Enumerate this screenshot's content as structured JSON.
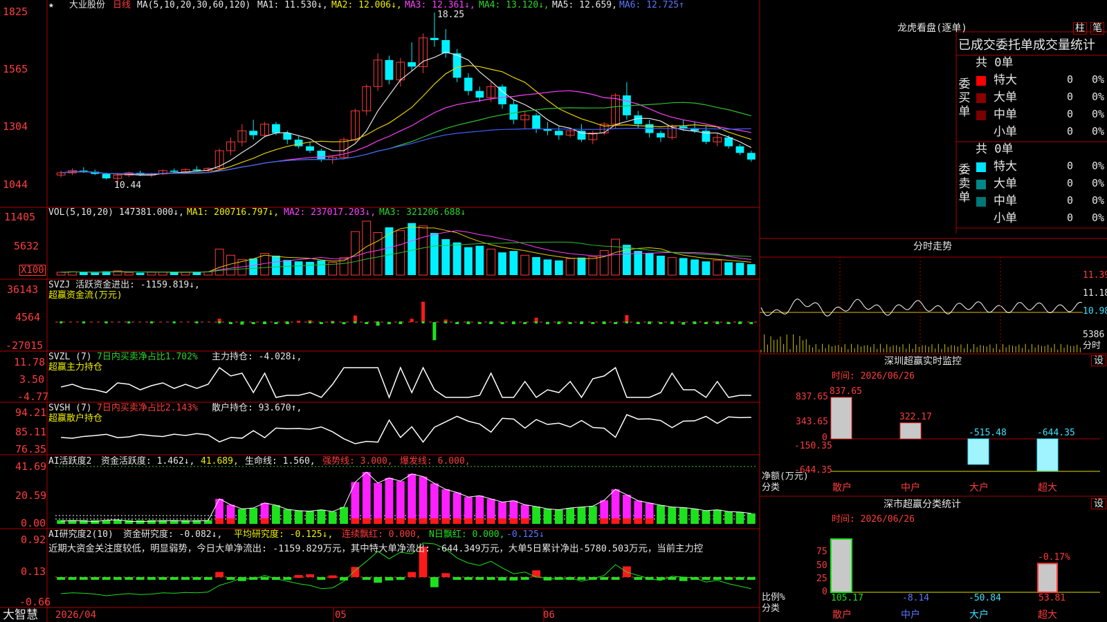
{
  "colors": {
    "bg": "#000000",
    "grid": "#b00000",
    "up": "#ff3c3c",
    "down": "#00f0ff",
    "ma1": "#e8e8e8",
    "ma2": "#e8d000",
    "ma3": "#ff40ff",
    "ma4": "#30c030",
    "ma5": "#4060ff",
    "ma6": "#4060ff"
  },
  "header": {
    "star": "★",
    "stock_name": "大业股份",
    "period": "日线",
    "ma_params": "MA(5,10,20,30,60,120)",
    "ma1": "MA1: 11.530↓,",
    "ma2": "MA2: 12.006↓,",
    "ma3": "MA3: 12.361↓,",
    "ma4": "MA4: 13.120↓,",
    "ma5": "MA5: 12.659,",
    "ma6": "MA6: 12.725↑"
  },
  "price_axis": [
    "1825",
    "1565",
    "1304",
    "1044"
  ],
  "price_labels": {
    "high": "18.25",
    "low": "10.44"
  },
  "vol": {
    "params": "VOL(5,10,20)",
    "value": "147381.000↓,",
    "ma1": "MA1: 200716.797↓,",
    "ma2": "MA2: 237017.203↓,",
    "ma3": "MA3: 321206.688↓",
    "axis": [
      "11405",
      "5632"
    ],
    "unit": "X100"
  },
  "svzj": {
    "title": "SVZJ  活跃资金进出: -1159.819↓,",
    "subtitle": "超赢资金流(万元)",
    "axis": [
      "36143",
      "4564",
      "-27015"
    ]
  },
  "svzl": {
    "title": "SVZL  (7)",
    "mid": "7日内买卖净占比1.702%",
    "tail": "主力持仓: -4.028↓,",
    "subtitle": "超赢主力持仓",
    "axis": [
      "11.78",
      "3.50",
      "-4.77"
    ]
  },
  "svsh": {
    "title": "SVSH  (7)",
    "mid": "7日内买卖净占比2.143%",
    "tail": "散户持仓: 93.670↑,",
    "subtitle": "超赢散户持仓",
    "axis": [
      "94.21",
      "85.11",
      "76.35"
    ]
  },
  "ai1": {
    "a": "AI活跃度2",
    "b": "资金活跃度: 1.462↓,",
    "c": "41.689,",
    "d": "生命线: 1.560,",
    "e": "强势线: 3.000,",
    "f": "爆发线: 6.000,",
    "axis": [
      "41.69",
      "20.59",
      "0.00"
    ]
  },
  "ai2": {
    "a": "AI研究度2(10)",
    "b": "资金研究度: -0.082↓,",
    "c": "平均研究度: -0.125↓,",
    "d": "连续飘红: 0.000,",
    "e": "N日飘红: 0.000,",
    "f": "-0.125↓",
    "axis": [
      "0.92",
      "0.13",
      "-0.66"
    ],
    "note": "近期大资金关注度较低，明显弱势，今日大单净流出: -1159.829万元，其中特大单净流出: -644.349万元，大单5日累计净出-5780.503万元，当前主力控"
  },
  "footer": {
    "brand": "大智慧",
    "dates": [
      "2026/04",
      "05",
      "06"
    ]
  },
  "dragon": {
    "title": "龙虎看盘(逐单)",
    "btn1": "柱",
    "btn2": "笔",
    "section": "已成交委托单成交量统计",
    "buy_label": "委买单",
    "sell_label": "委卖单",
    "buy_total": "共 0单",
    "sell_total": "共 0单",
    "buy": [
      {
        "name": "特大",
        "count": "0",
        "pct": "0%",
        "color": "#ff0000"
      },
      {
        "name": "大单",
        "count": "0",
        "pct": "0%",
        "color": "#8b0000"
      },
      {
        "name": "中单",
        "count": "0",
        "pct": "0%",
        "color": "#7a0000"
      },
      {
        "name": "小单",
        "count": "0",
        "pct": "0%",
        "color": "#000000"
      }
    ],
    "sell": [
      {
        "name": "特大",
        "count": "0",
        "pct": "0%",
        "color": "#00e5ff"
      },
      {
        "name": "大单",
        "count": "0",
        "pct": "0%",
        "color": "#008888"
      },
      {
        "name": "中单",
        "count": "0",
        "pct": "0%",
        "color": "#007777"
      },
      {
        "name": "小单",
        "count": "0",
        "pct": "0%",
        "color": "#000000"
      }
    ]
  },
  "intraday": {
    "title": "分时走势",
    "axis": [
      "11.39",
      "11.18",
      "10.98"
    ],
    "vol_value": "5386",
    "vol_label": "分时"
  },
  "monitor": {
    "title": "深圳超赢实时监控",
    "btn": "设",
    "time": "时间: 2026/06/26",
    "axis": [
      "837.65",
      "343.65",
      "0",
      "-150.35",
      "-644.35"
    ],
    "ylabel": "净额(万元)",
    "xlabel": "分类",
    "cats": [
      "散户",
      "中户",
      "大户",
      "超大"
    ],
    "values": [
      "837.65",
      "322.17",
      "-515.48",
      "-644.35"
    ]
  },
  "stats": {
    "title": "深市超赢分类统计",
    "btn": "设",
    "time": "时间: 2026/06/26",
    "axis": [
      "75",
      "50",
      "25",
      "0"
    ],
    "ylabel": "比例%",
    "xlabel": "分类",
    "cats": [
      "散户",
      "中户",
      "大户",
      "超大"
    ],
    "values": [
      "105.17",
      "-8.14",
      "-50.84",
      "53.81"
    ],
    "top_label": "-0.17%"
  },
  "chart_data": [
    {
      "type": "candlestick",
      "title": "大业股份 日线",
      "ylim": [
        10.44,
        18.25
      ],
      "x_ticks": [
        "2026/04",
        "05",
        "06"
      ],
      "ohlc": [
        [
          10.9,
          11.1,
          10.8,
          11.0
        ],
        [
          11.0,
          11.2,
          10.9,
          11.1
        ],
        [
          11.1,
          11.25,
          11.0,
          11.05
        ],
        [
          11.05,
          11.15,
          10.9,
          10.95
        ],
        [
          10.95,
          11.0,
          10.7,
          10.75
        ],
        [
          10.75,
          11.0,
          10.44,
          10.9
        ],
        [
          10.9,
          11.05,
          10.8,
          11.0
        ],
        [
          11.0,
          11.1,
          10.85,
          10.9
        ],
        [
          10.9,
          11.0,
          10.8,
          10.95
        ],
        [
          10.95,
          11.15,
          10.9,
          11.1
        ],
        [
          11.1,
          11.2,
          11.0,
          11.05
        ],
        [
          11.05,
          11.2,
          11.0,
          11.15
        ],
        [
          11.15,
          11.3,
          11.05,
          11.1
        ],
        [
          11.1,
          11.25,
          11.0,
          11.2
        ],
        [
          11.2,
          12.1,
          11.15,
          12.0
        ],
        [
          12.0,
          12.6,
          11.8,
          12.4
        ],
        [
          12.4,
          13.2,
          12.2,
          12.9
        ],
        [
          12.9,
          13.4,
          12.5,
          12.7
        ],
        [
          12.7,
          13.3,
          12.6,
          13.2
        ],
        [
          13.2,
          13.3,
          12.7,
          12.8
        ],
        [
          12.8,
          12.9,
          12.3,
          12.5
        ],
        [
          12.5,
          12.7,
          12.1,
          12.2
        ],
        [
          12.2,
          12.4,
          11.9,
          12.0
        ],
        [
          12.0,
          12.1,
          11.5,
          11.6
        ],
        [
          11.6,
          11.8,
          11.4,
          11.7
        ],
        [
          11.7,
          12.6,
          11.6,
          12.5
        ],
        [
          12.5,
          13.9,
          12.4,
          13.8
        ],
        [
          13.8,
          15.0,
          13.6,
          14.9
        ],
        [
          14.9,
          16.4,
          14.7,
          16.1
        ],
        [
          16.1,
          16.3,
          15.0,
          15.2
        ],
        [
          15.2,
          16.2,
          14.9,
          16.0
        ],
        [
          16.0,
          16.9,
          15.6,
          15.8
        ],
        [
          15.8,
          17.3,
          15.5,
          17.1
        ],
        [
          17.1,
          18.25,
          16.7,
          17.0
        ],
        [
          17.0,
          17.5,
          16.2,
          16.4
        ],
        [
          16.4,
          16.6,
          15.1,
          15.3
        ],
        [
          15.3,
          15.5,
          14.5,
          14.7
        ],
        [
          14.7,
          14.9,
          14.2,
          14.4
        ],
        [
          14.4,
          15.1,
          14.2,
          14.9
        ],
        [
          14.9,
          15.0,
          13.9,
          14.1
        ],
        [
          14.1,
          14.3,
          13.2,
          13.4
        ],
        [
          13.4,
          13.8,
          13.0,
          13.6
        ],
        [
          13.6,
          13.7,
          12.8,
          13.0
        ],
        [
          13.0,
          13.3,
          12.7,
          12.9
        ],
        [
          12.9,
          13.1,
          12.5,
          12.7
        ],
        [
          12.7,
          13.0,
          12.6,
          12.9
        ],
        [
          12.9,
          13.2,
          12.4,
          12.5
        ],
        [
          12.5,
          12.9,
          12.3,
          12.8
        ],
        [
          12.8,
          13.3,
          12.7,
          13.2
        ],
        [
          13.2,
          14.6,
          13.0,
          14.5
        ],
        [
          14.5,
          15.1,
          13.4,
          13.6
        ],
        [
          13.6,
          13.8,
          13.0,
          13.2
        ],
        [
          13.2,
          13.4,
          12.6,
          12.8
        ],
        [
          12.8,
          12.9,
          12.4,
          12.6
        ],
        [
          12.6,
          13.2,
          12.5,
          13.1
        ],
        [
          13.1,
          13.4,
          12.9,
          13.0
        ],
        [
          13.0,
          13.3,
          12.8,
          12.9
        ],
        [
          12.9,
          13.1,
          12.3,
          12.4
        ],
        [
          12.4,
          12.8,
          12.2,
          12.6
        ],
        [
          12.6,
          12.7,
          12.1,
          12.2
        ],
        [
          12.2,
          12.3,
          11.8,
          11.9
        ],
        [
          11.9,
          12.0,
          11.5,
          11.6
        ]
      ]
    },
    {
      "type": "bar",
      "title": "VOL(5,10,20)",
      "unit": "X100",
      "ylim": [
        0,
        11405
      ],
      "values": [
        600,
        700,
        650,
        500,
        800,
        900,
        550,
        500,
        600,
        650,
        700,
        600,
        650,
        700,
        5500,
        4200,
        3300,
        3500,
        4600,
        4100,
        3200,
        2900,
        2800,
        3100,
        2700,
        3700,
        9200,
        11405,
        9000,
        10100,
        9400,
        11000,
        10400,
        8900,
        7600,
        6900,
        5900,
        6200,
        5500,
        4800,
        5100,
        4200,
        3800,
        3300,
        3100,
        3500,
        3700,
        3900,
        5200,
        7600,
        6400,
        5100,
        4600,
        4100,
        3700,
        3600,
        3300,
        2900,
        3100,
        2700,
        2600,
        2300
      ]
    },
    {
      "type": "bar",
      "title": "超赢资金流(万元)",
      "ylim": [
        -27015,
        36143
      ],
      "values": [
        0,
        0,
        0,
        0,
        0,
        0,
        0,
        0,
        0,
        0,
        0,
        0,
        0,
        0,
        4564,
        -1500,
        -3500,
        -2000,
        -1500,
        -2500,
        -1000,
        1800,
        2500,
        -2000,
        1500,
        -3000,
        9000,
        -1500,
        -5000,
        -3000,
        -1500,
        4500,
        28000,
        -25000,
        3500,
        -2500,
        -2000,
        -1500,
        -2500,
        -3000,
        -3000,
        -1200,
        6000,
        -3000,
        -2000,
        -1500,
        -1200,
        -900,
        -800,
        -1500,
        9500,
        -1500,
        -1000,
        -800,
        -700,
        -3500,
        -1200,
        -1000,
        -900,
        -800,
        -700,
        -600
      ]
    },
    {
      "type": "line",
      "title": "超赢主力持仓",
      "ylim": [
        -4.77,
        11.78
      ]
    },
    {
      "type": "line",
      "title": "超赢散户持仓",
      "ylim": [
        76.35,
        94.21
      ]
    },
    {
      "type": "bar",
      "title": "AI活跃度2",
      "ylim": [
        0,
        41.69
      ]
    },
    {
      "type": "bar",
      "title": "AI研究度2(10)",
      "ylim": [
        -0.66,
        0.92
      ]
    },
    {
      "type": "bar",
      "title": "深圳超赢实时监控",
      "categories": [
        "散户",
        "中户",
        "大户",
        "超大"
      ],
      "values": [
        837.65,
        322.17,
        -515.48,
        -644.35
      ],
      "ylim": [
        -644.35,
        837.65
      ]
    },
    {
      "type": "bar",
      "title": "深市超赢分类统计",
      "categories": [
        "散户",
        "中户",
        "大户",
        "超大"
      ],
      "values": [
        105.17,
        -8.14,
        -50.84,
        53.81
      ],
      "ylim": [
        0,
        75
      ]
    }
  ]
}
